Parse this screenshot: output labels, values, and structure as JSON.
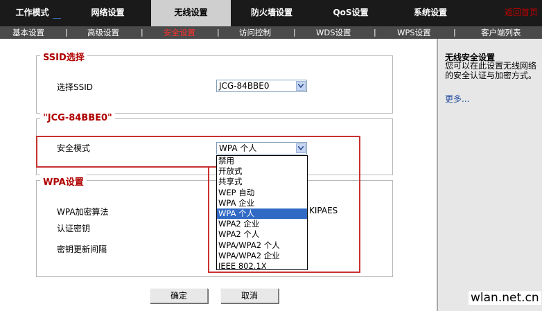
{
  "topnav": {
    "items": [
      {
        "label": "工作模式"
      },
      {
        "label": "网络设置"
      },
      {
        "label": "无线设置"
      },
      {
        "label": "防火墙设置"
      },
      {
        "label": "QoS设置"
      },
      {
        "label": "系统设置"
      }
    ],
    "return_label": "返回首页"
  },
  "subnav": {
    "items": [
      {
        "label": "基本设置"
      },
      {
        "label": "高级设置"
      },
      {
        "label": "安全设置"
      },
      {
        "label": "访问控制"
      },
      {
        "label": "WDS设置"
      },
      {
        "label": "WPS设置"
      },
      {
        "label": "客户端列表"
      }
    ],
    "separator": "|"
  },
  "ssid_section": {
    "legend": "SSID选择",
    "label": "选择SSID",
    "value": "JCG-84BBE0"
  },
  "network_section": {
    "legend": "\"JCG-84BBE0\"",
    "security_label": "安全模式",
    "security_value": "WPA 个人"
  },
  "wpa_section": {
    "legend": "WPA设置",
    "cipher_label": "WPA加密算法",
    "cipher_value_partial": "KIPAES",
    "key_label": "认证密钥",
    "interval_label": "密钥更新间隔"
  },
  "dropdown": {
    "options": [
      "禁用",
      "开放式",
      "共享式",
      "WEP 自动",
      "WPA 企业",
      "WPA 个人",
      "WPA2 企业",
      "WPA2 个人",
      "WPA/WPA2 个人",
      "WPA/WPA2 企业",
      "IEEE 802.1X"
    ],
    "selected": "WPA 个人"
  },
  "buttons": {
    "ok": "确定",
    "cancel": "取消"
  },
  "sidebar": {
    "title": "无线安全设置",
    "description": "您可以在此设置无线网络的安全认证与加密方式。",
    "more": "更多..."
  },
  "watermark": "wlan.net.cn",
  "colors": {
    "topnav_bg": "#1a1a1a",
    "subnav_bg": "#4a4a4a",
    "active_tab_bg": "#cfcfcf",
    "legend_red": "#b00000",
    "highlight_red": "#c83232",
    "selected_blue": "#316ac5"
  }
}
